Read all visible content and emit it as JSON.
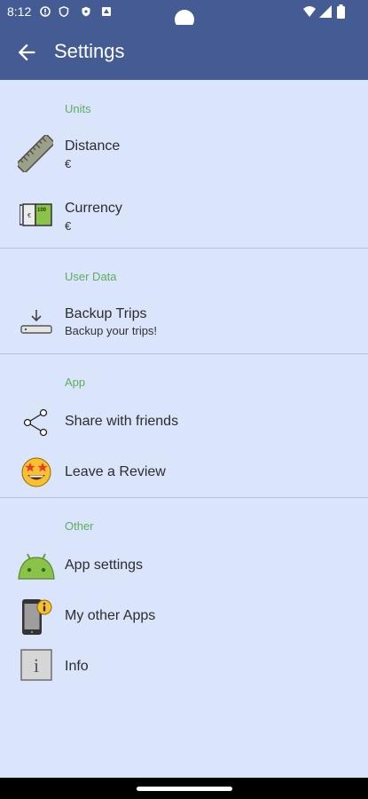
{
  "status_bar": {
    "time": "8:12",
    "icons": [
      "alert-circle-icon",
      "shield-icon",
      "vpn-shield-icon",
      "storage-icon",
      "wifi-icon",
      "signal-icon",
      "battery-icon"
    ]
  },
  "app_bar": {
    "title": "Settings",
    "back_icon": "arrow-back-icon",
    "color": "#445c93"
  },
  "sections": {
    "units": "Units",
    "user_data": "User Data",
    "app": "App",
    "other": "Other"
  },
  "items": {
    "distance": {
      "label": "Distance",
      "sub": "€",
      "icon": "ruler-icon"
    },
    "currency": {
      "label": "Currency",
      "sub": "€",
      "icon": "banknote-icon",
      "icon_text": "100"
    },
    "backup": {
      "label": "Backup Trips",
      "sub": "Backup your trips!",
      "icon": "download-tray-icon"
    },
    "share": {
      "label": "Share with friends",
      "icon": "share-icon"
    },
    "review": {
      "label": "Leave a Review",
      "icon": "star-eyes-emoji-icon"
    },
    "app_settings": {
      "label": "App settings",
      "icon": "android-icon"
    },
    "other_apps": {
      "label": "My other Apps",
      "icon": "phone-info-icon"
    },
    "info": {
      "label": "Info",
      "icon": "info-box-icon",
      "icon_text": "i"
    }
  },
  "colors": {
    "background": "#dae4fb",
    "section_header": "#5dae5f",
    "text": "#2d2d2d"
  }
}
